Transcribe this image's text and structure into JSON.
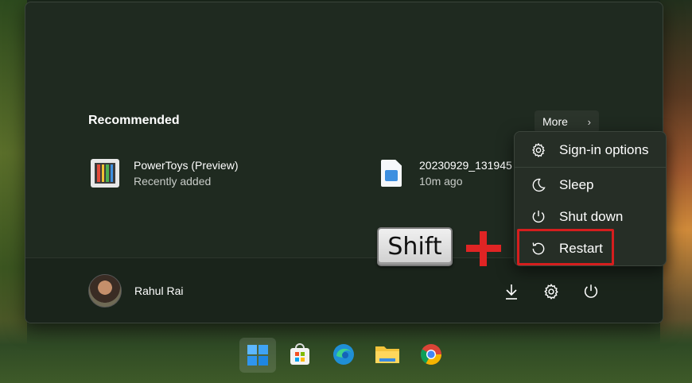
{
  "recommended": {
    "title": "Recommended",
    "more_label": "More",
    "items": [
      {
        "name": "PowerToys (Preview)",
        "sub": "Recently added",
        "icon": "powertoys-icon"
      },
      {
        "name": "20230929_131945",
        "sub": "10m ago",
        "icon": "image-file-icon"
      }
    ]
  },
  "user": {
    "name": "Rahul Rai"
  },
  "power_menu": {
    "items": [
      {
        "label": "Sign-in options",
        "icon": "gear-icon"
      },
      {
        "label": "Sleep",
        "icon": "moon-icon"
      },
      {
        "label": "Shut down",
        "icon": "power-icon"
      },
      {
        "label": "Restart",
        "icon": "restart-icon"
      }
    ]
  },
  "annotation": {
    "key_label": "Shift",
    "highlight_color": "#d51e1e"
  },
  "taskbar": {
    "icons": [
      "windows-start-icon",
      "microsoft-store-icon",
      "edge-icon",
      "file-explorer-icon",
      "chrome-icon"
    ]
  },
  "colors": {
    "menu_bg": "#1f2a20",
    "accent": "#3d8fe0"
  }
}
